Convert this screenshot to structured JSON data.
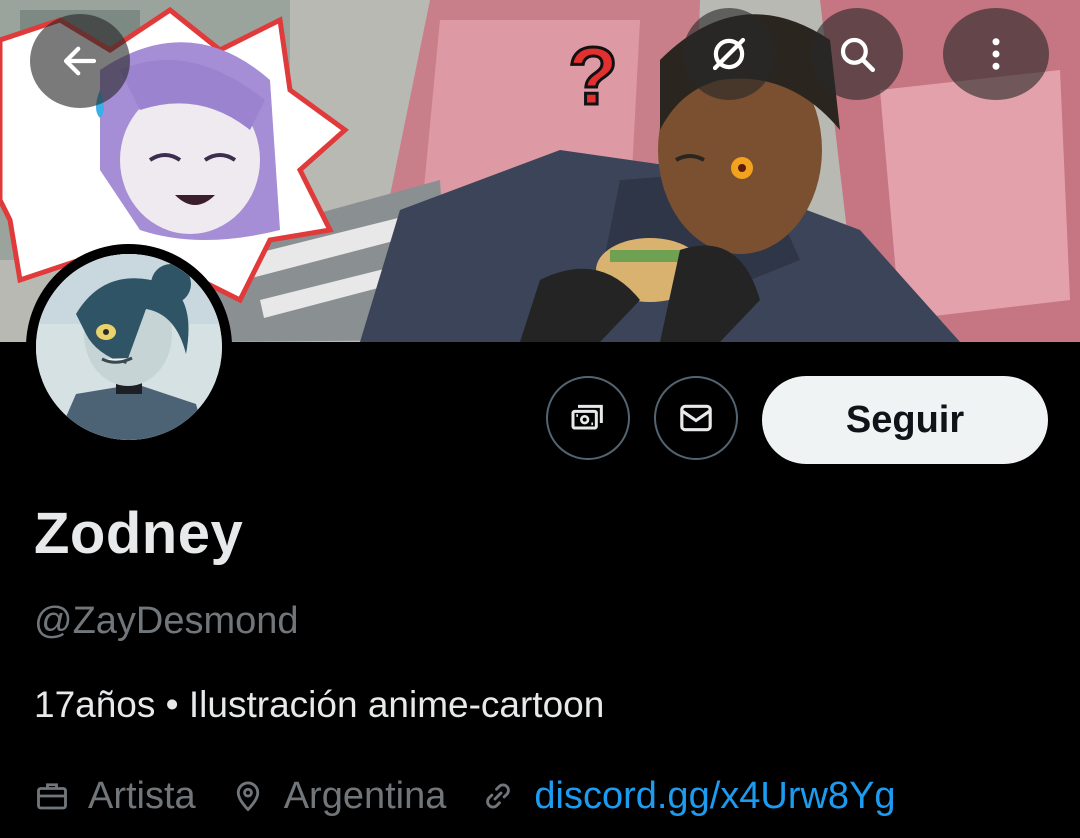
{
  "header": {
    "back_icon": "arrow-left-icon",
    "offline_icon": "circle-slash-icon",
    "search_icon": "search-icon",
    "more_icon": "more-vertical-icon"
  },
  "banner": {
    "question_mark": "?"
  },
  "actions": {
    "tips_icon": "money-icon",
    "message_icon": "envelope-icon",
    "follow_label": "Seguir"
  },
  "profile": {
    "display_name": "Zodney",
    "handle": "@ZayDesmond",
    "bio": "17años • Ilustración anime-cartoon",
    "profession": "Artista",
    "location": "Argentina",
    "website": "discord.gg/x4Urw8Yg"
  },
  "colors": {
    "background": "#000000",
    "primary_text": "#e7e9ea",
    "secondary_text": "#71767b",
    "link": "#1d9bf0",
    "follow_button_bg": "#eff3f4"
  }
}
